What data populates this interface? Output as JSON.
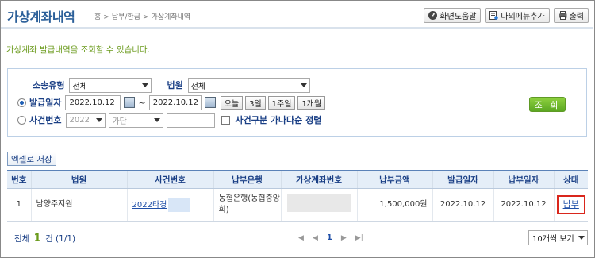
{
  "header": {
    "title": "가상계좌내역",
    "breadcrumb": [
      "홈",
      "납부/환급",
      "가상계좌내역"
    ],
    "buttons": [
      {
        "label": "화면도움말",
        "icon": "help-icon"
      },
      {
        "label": "나의메뉴추가",
        "icon": "add-menu-icon"
      },
      {
        "label": "출력",
        "icon": "print-icon"
      }
    ]
  },
  "description": "가상계좌 발급내역을 조회할 수 있습니다.",
  "search": {
    "send_type_label": "소송유형",
    "send_type_value": "전체",
    "court_label": "법원",
    "court_value": "전체",
    "issue_date_label": "발급일자",
    "date_from": "2022.10.12",
    "date_sep": "~",
    "date_to": "2022.10.12",
    "quick_buttons": [
      "오늘",
      "3일",
      "1주일",
      "1개월"
    ],
    "case_no_label": "사건번호",
    "year_value": "2022",
    "case_type_value": "가단",
    "case_num_value": "",
    "sort_label": "사건구분 가나다순 정렬",
    "query_label": "조 회"
  },
  "excel_button": "엑셀로 저장",
  "table": {
    "headers": [
      "번호",
      "법원",
      "사건번호",
      "납부은행",
      "가상계좌번호",
      "납부금액",
      "발급일자",
      "납부일자",
      "상태"
    ],
    "rows": [
      {
        "no": "1",
        "court": "남양주지원",
        "case_no": "2022타경",
        "bank": "농협은행(농협중앙회)",
        "account": "",
        "amount": "1,500,000원",
        "issue_date": "2022.10.12",
        "pay_date": "2022.10.12",
        "status": "납부"
      }
    ]
  },
  "footer": {
    "total_prefix": "전체",
    "total_count": "1",
    "total_suffix": "건 (1/1)",
    "current_page": "1",
    "per_page": "10개씩 보기"
  }
}
